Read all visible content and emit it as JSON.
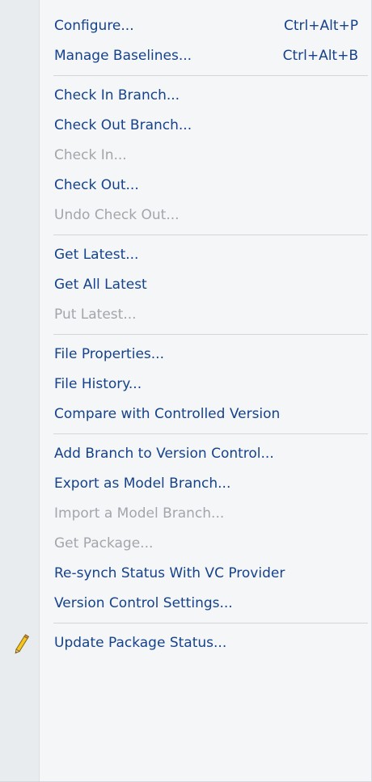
{
  "menu": {
    "groups": [
      {
        "items": [
          {
            "label": "Configure...",
            "shortcut": "Ctrl+Alt+P",
            "enabled": true
          },
          {
            "label": "Manage Baselines...",
            "shortcut": "Ctrl+Alt+B",
            "enabled": true
          }
        ]
      },
      {
        "items": [
          {
            "label": "Check In Branch...",
            "enabled": true
          },
          {
            "label": "Check Out Branch...",
            "enabled": true
          },
          {
            "label": "Check In...",
            "enabled": false
          },
          {
            "label": "Check Out...",
            "enabled": true
          },
          {
            "label": "Undo Check Out...",
            "enabled": false
          }
        ]
      },
      {
        "items": [
          {
            "label": "Get Latest...",
            "enabled": true
          },
          {
            "label": "Get All Latest",
            "enabled": true
          },
          {
            "label": "Put Latest...",
            "enabled": false
          }
        ]
      },
      {
        "items": [
          {
            "label": "File Properties...",
            "enabled": true
          },
          {
            "label": "File History...",
            "enabled": true
          },
          {
            "label": "Compare with Controlled Version",
            "enabled": true
          }
        ]
      },
      {
        "items": [
          {
            "label": "Add Branch to Version Control...",
            "enabled": true
          },
          {
            "label": "Export as Model Branch...",
            "enabled": true
          },
          {
            "label": "Import a Model Branch...",
            "enabled": false
          },
          {
            "label": "Get Package...",
            "enabled": false
          },
          {
            "label": "Re-synch Status With VC Provider",
            "enabled": true
          },
          {
            "label": "Version Control Settings...",
            "enabled": true
          }
        ]
      },
      {
        "items": [
          {
            "label": "Update Package Status...",
            "enabled": true,
            "icon": "pencil-icon"
          }
        ]
      }
    ]
  },
  "colors": {
    "enabled_text": "#15428b",
    "disabled_text": "#a2a6ab",
    "menu_background": "#f5f6f7",
    "gutter_background": "#e9ecef",
    "separator": "#d4d6d9"
  }
}
